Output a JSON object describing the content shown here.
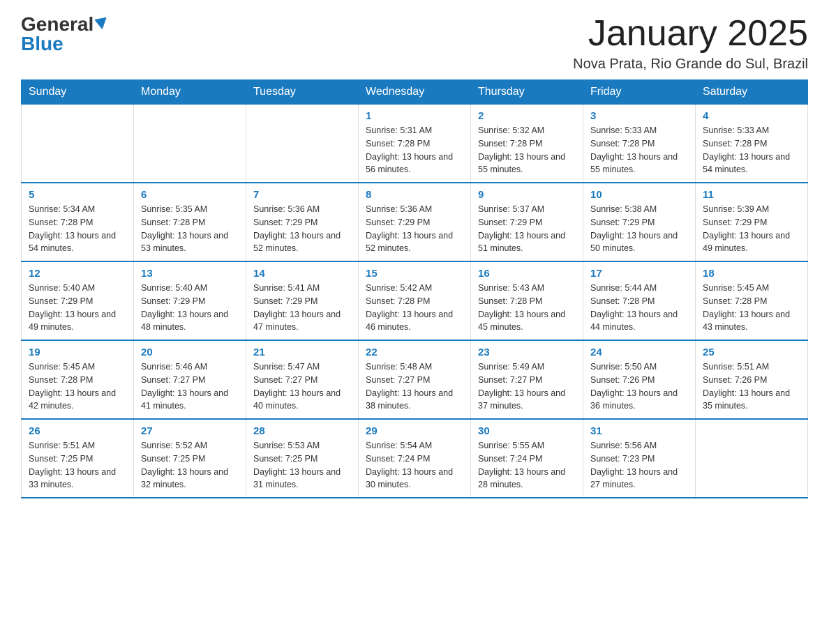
{
  "logo": {
    "general": "General",
    "blue": "Blue"
  },
  "title": "January 2025",
  "location": "Nova Prata, Rio Grande do Sul, Brazil",
  "days_of_week": [
    "Sunday",
    "Monday",
    "Tuesday",
    "Wednesday",
    "Thursday",
    "Friday",
    "Saturday"
  ],
  "weeks": [
    [
      {
        "day": "",
        "info": ""
      },
      {
        "day": "",
        "info": ""
      },
      {
        "day": "",
        "info": ""
      },
      {
        "day": "1",
        "info": "Sunrise: 5:31 AM\nSunset: 7:28 PM\nDaylight: 13 hours and 56 minutes."
      },
      {
        "day": "2",
        "info": "Sunrise: 5:32 AM\nSunset: 7:28 PM\nDaylight: 13 hours and 55 minutes."
      },
      {
        "day": "3",
        "info": "Sunrise: 5:33 AM\nSunset: 7:28 PM\nDaylight: 13 hours and 55 minutes."
      },
      {
        "day": "4",
        "info": "Sunrise: 5:33 AM\nSunset: 7:28 PM\nDaylight: 13 hours and 54 minutes."
      }
    ],
    [
      {
        "day": "5",
        "info": "Sunrise: 5:34 AM\nSunset: 7:28 PM\nDaylight: 13 hours and 54 minutes."
      },
      {
        "day": "6",
        "info": "Sunrise: 5:35 AM\nSunset: 7:28 PM\nDaylight: 13 hours and 53 minutes."
      },
      {
        "day": "7",
        "info": "Sunrise: 5:36 AM\nSunset: 7:29 PM\nDaylight: 13 hours and 52 minutes."
      },
      {
        "day": "8",
        "info": "Sunrise: 5:36 AM\nSunset: 7:29 PM\nDaylight: 13 hours and 52 minutes."
      },
      {
        "day": "9",
        "info": "Sunrise: 5:37 AM\nSunset: 7:29 PM\nDaylight: 13 hours and 51 minutes."
      },
      {
        "day": "10",
        "info": "Sunrise: 5:38 AM\nSunset: 7:29 PM\nDaylight: 13 hours and 50 minutes."
      },
      {
        "day": "11",
        "info": "Sunrise: 5:39 AM\nSunset: 7:29 PM\nDaylight: 13 hours and 49 minutes."
      }
    ],
    [
      {
        "day": "12",
        "info": "Sunrise: 5:40 AM\nSunset: 7:29 PM\nDaylight: 13 hours and 49 minutes."
      },
      {
        "day": "13",
        "info": "Sunrise: 5:40 AM\nSunset: 7:29 PM\nDaylight: 13 hours and 48 minutes."
      },
      {
        "day": "14",
        "info": "Sunrise: 5:41 AM\nSunset: 7:29 PM\nDaylight: 13 hours and 47 minutes."
      },
      {
        "day": "15",
        "info": "Sunrise: 5:42 AM\nSunset: 7:28 PM\nDaylight: 13 hours and 46 minutes."
      },
      {
        "day": "16",
        "info": "Sunrise: 5:43 AM\nSunset: 7:28 PM\nDaylight: 13 hours and 45 minutes."
      },
      {
        "day": "17",
        "info": "Sunrise: 5:44 AM\nSunset: 7:28 PM\nDaylight: 13 hours and 44 minutes."
      },
      {
        "day": "18",
        "info": "Sunrise: 5:45 AM\nSunset: 7:28 PM\nDaylight: 13 hours and 43 minutes."
      }
    ],
    [
      {
        "day": "19",
        "info": "Sunrise: 5:45 AM\nSunset: 7:28 PM\nDaylight: 13 hours and 42 minutes."
      },
      {
        "day": "20",
        "info": "Sunrise: 5:46 AM\nSunset: 7:27 PM\nDaylight: 13 hours and 41 minutes."
      },
      {
        "day": "21",
        "info": "Sunrise: 5:47 AM\nSunset: 7:27 PM\nDaylight: 13 hours and 40 minutes."
      },
      {
        "day": "22",
        "info": "Sunrise: 5:48 AM\nSunset: 7:27 PM\nDaylight: 13 hours and 38 minutes."
      },
      {
        "day": "23",
        "info": "Sunrise: 5:49 AM\nSunset: 7:27 PM\nDaylight: 13 hours and 37 minutes."
      },
      {
        "day": "24",
        "info": "Sunrise: 5:50 AM\nSunset: 7:26 PM\nDaylight: 13 hours and 36 minutes."
      },
      {
        "day": "25",
        "info": "Sunrise: 5:51 AM\nSunset: 7:26 PM\nDaylight: 13 hours and 35 minutes."
      }
    ],
    [
      {
        "day": "26",
        "info": "Sunrise: 5:51 AM\nSunset: 7:25 PM\nDaylight: 13 hours and 33 minutes."
      },
      {
        "day": "27",
        "info": "Sunrise: 5:52 AM\nSunset: 7:25 PM\nDaylight: 13 hours and 32 minutes."
      },
      {
        "day": "28",
        "info": "Sunrise: 5:53 AM\nSunset: 7:25 PM\nDaylight: 13 hours and 31 minutes."
      },
      {
        "day": "29",
        "info": "Sunrise: 5:54 AM\nSunset: 7:24 PM\nDaylight: 13 hours and 30 minutes."
      },
      {
        "day": "30",
        "info": "Sunrise: 5:55 AM\nSunset: 7:24 PM\nDaylight: 13 hours and 28 minutes."
      },
      {
        "day": "31",
        "info": "Sunrise: 5:56 AM\nSunset: 7:23 PM\nDaylight: 13 hours and 27 minutes."
      },
      {
        "day": "",
        "info": ""
      }
    ]
  ]
}
